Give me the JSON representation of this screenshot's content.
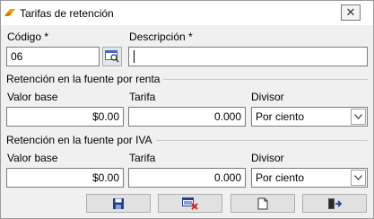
{
  "window": {
    "title": "Tarifas de retención",
    "close_label": "✕"
  },
  "codigo": {
    "label": "Código *",
    "value": "06"
  },
  "descripcion": {
    "label": "Descripción *",
    "value": ""
  },
  "renta": {
    "section_title": "Retención en la fuente por renta",
    "valor_base_label": "Valor base",
    "valor_base_value": "$0.00",
    "tarifa_label": "Tarifa",
    "tarifa_value": "0.000",
    "divisor_label": "Divisor",
    "divisor_value": "Por ciento"
  },
  "iva": {
    "section_title": "Retención en la fuente por IVA",
    "valor_base_label": "Valor base",
    "valor_base_value": "$0.00",
    "tarifa_label": "Tarifa",
    "tarifa_value": "0.000",
    "divisor_label": "Divisor",
    "divisor_value": "Por ciento"
  },
  "toolbar": {
    "buttons": [
      "save-icon",
      "cancel-icon",
      "new-document-icon",
      "exit-icon"
    ]
  },
  "colors": {
    "accent_orange": "#f5a000",
    "icon_blue": "#1f3f8f",
    "icon_red": "#d42020"
  }
}
